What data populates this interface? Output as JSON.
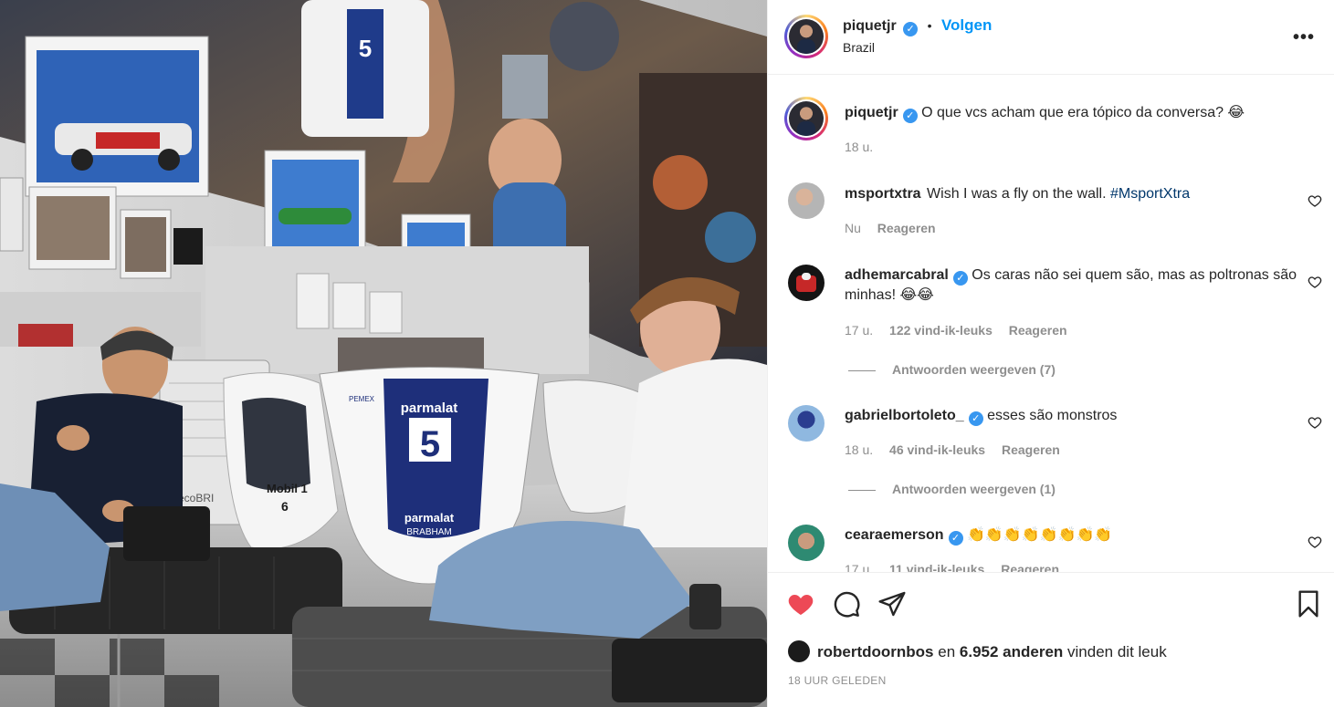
{
  "post": {
    "username": "piquetjr",
    "follow_label": "Volgen",
    "location": "Brazil",
    "more_label": "•••",
    "caption": "O que vcs acham que era tópico da conversa? 😂",
    "caption_time": "18 u."
  },
  "photo": {
    "chair_brand": "parmalat",
    "chair_number": "5",
    "chair_brand_lower": "parmalat",
    "chair_team": "BRABHAM",
    "sponsor_side": "PEMEX",
    "left_chair_sponsor": "Mobil 1",
    "left_chair_number": "6",
    "fan_brand": "ecoBRI"
  },
  "comments": [
    {
      "username": "msportxtra",
      "verified": false,
      "text": "Wish I was a fly on the wall.",
      "hashtag": "#MsportXtra",
      "time": "Nu",
      "likes": "",
      "reply_label": "Reageren"
    },
    {
      "username": "adhemarcabral",
      "verified": true,
      "text": "Os caras não sei quem são, mas as poltronas são minhas! 😂😂",
      "time": "17 u.",
      "likes": "122 vind-ik-leuks",
      "reply_label": "Reageren",
      "view_replies": "Antwoorden weergeven (7)"
    },
    {
      "username": "gabrielbortoleto_",
      "verified": true,
      "text": "esses são monstros",
      "time": "18 u.",
      "likes": "46 vind-ik-leuks",
      "reply_label": "Reageren",
      "view_replies": "Antwoorden weergeven (1)"
    },
    {
      "username": "cearaemerson",
      "verified": true,
      "text": "👏👏👏👏👏👏👏👏",
      "time": "17 u.",
      "likes": "11 vind-ik-leuks",
      "reply_label": "Reageren"
    }
  ],
  "footer": {
    "liker": "robertdoornbos",
    "liked_joiner": "en",
    "others": "6.952 anderen",
    "liked_suffix": "vinden dit leuk",
    "posted": "18 UUR GELEDEN"
  },
  "colors": {
    "link": "#0095f6",
    "liked_heart": "#ed4956",
    "verified": "#3897f0",
    "muted": "#8e8e8e"
  },
  "icons": [
    "verified-badge-icon",
    "heart-icon",
    "comment-icon",
    "share-icon",
    "bookmark-icon",
    "more-icon"
  ]
}
